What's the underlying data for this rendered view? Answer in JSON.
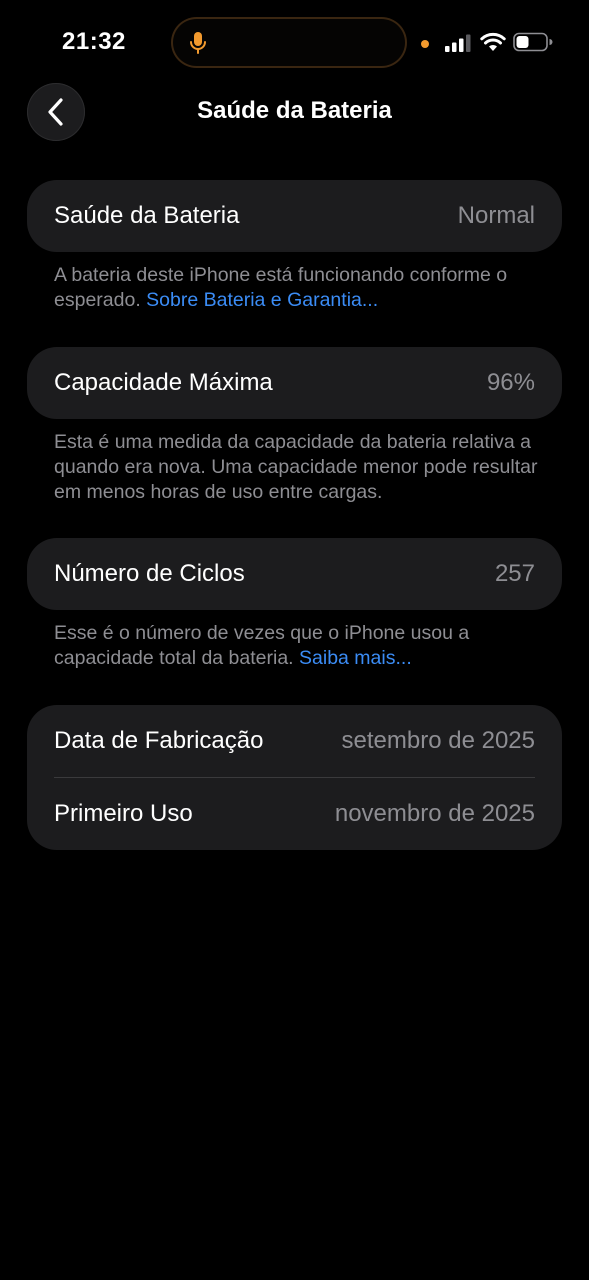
{
  "status_bar": {
    "time": "21:32"
  },
  "nav": {
    "title": "Saúde da Bateria"
  },
  "colors": {
    "background": "#000000",
    "card": "#1c1c1e",
    "link": "#3b8cf5",
    "secondary_text": "#8e8e93",
    "privacy_indicator": "#f29a2e"
  },
  "sections": {
    "health": {
      "label": "Saúde da Bateria",
      "value": "Normal",
      "footnote_text": "A bateria deste iPhone está funcionando conforme o esperado.",
      "footnote_link": "Sobre Bateria e Garantia..."
    },
    "capacity": {
      "label": "Capacidade Máxima",
      "value": "96%",
      "footnote_text": "Esta é uma medida da capacidade da bateria relativa a quando era nova. Uma capacidade menor pode resultar em menos horas de uso entre cargas."
    },
    "cycles": {
      "label": "Número de Ciclos",
      "value": "257",
      "footnote_text": "Esse é o número de vezes que o iPhone usou a capacidade total da bateria.",
      "footnote_link": "Saiba mais..."
    },
    "dates": {
      "manufacture_label": "Data de Fabricação",
      "manufacture_value": "setembro de 2025",
      "first_use_label": "Primeiro Uso",
      "first_use_value": "novembro de 2025"
    }
  },
  "icons": {
    "back": "chevron-left-icon",
    "mic": "microphone-icon",
    "signal": "cellular-signal-icon",
    "wifi": "wifi-icon",
    "battery": "battery-icon"
  }
}
